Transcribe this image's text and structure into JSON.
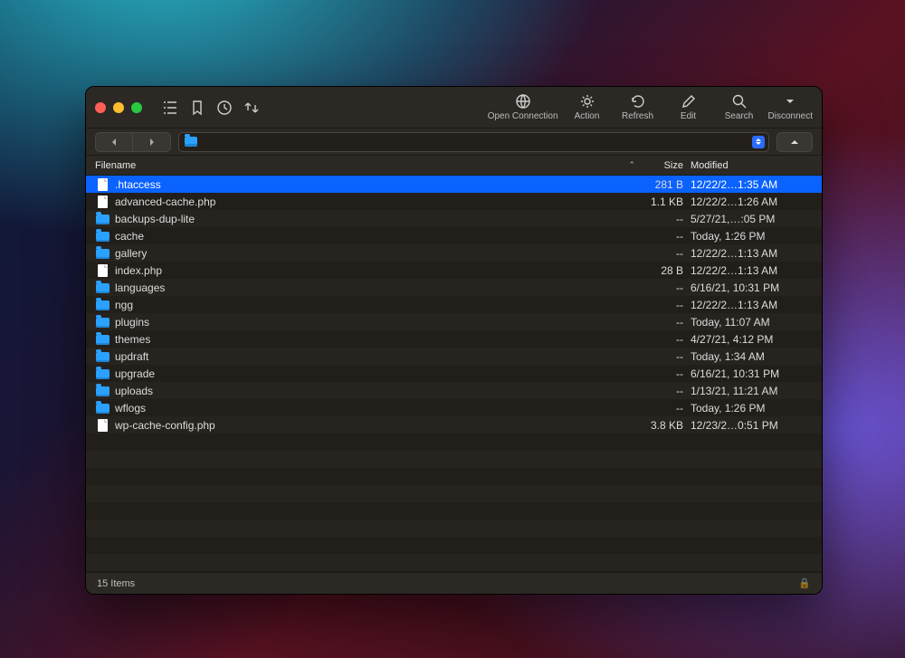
{
  "toolbar": {
    "buttons": {
      "open_connection": "Open Connection",
      "action": "Action",
      "refresh": "Refresh",
      "edit": "Edit",
      "search": "Search",
      "disconnect": "Disconnect"
    }
  },
  "path": {
    "value": ""
  },
  "columns": {
    "filename": "Filename",
    "size": "Size",
    "modified": "Modified"
  },
  "files": [
    {
      "name": ".htaccess",
      "type": "file",
      "size": "281 B",
      "modified": "12/22/2…1:35 AM",
      "selected": true
    },
    {
      "name": "advanced-cache.php",
      "type": "file",
      "size": "1.1 KB",
      "modified": "12/22/2…1:26 AM"
    },
    {
      "name": "backups-dup-lite",
      "type": "folder",
      "size": "--",
      "modified": "5/27/21,…:05 PM"
    },
    {
      "name": "cache",
      "type": "folder",
      "size": "--",
      "modified": "Today, 1:26 PM"
    },
    {
      "name": "gallery",
      "type": "folder",
      "size": "--",
      "modified": "12/22/2…1:13 AM"
    },
    {
      "name": "index.php",
      "type": "file",
      "size": "28 B",
      "modified": "12/22/2…1:13 AM"
    },
    {
      "name": "languages",
      "type": "folder",
      "size": "--",
      "modified": "6/16/21, 10:31 PM"
    },
    {
      "name": "ngg",
      "type": "folder",
      "size": "--",
      "modified": "12/22/2…1:13 AM"
    },
    {
      "name": "plugins",
      "type": "folder",
      "size": "--",
      "modified": "Today, 11:07 AM"
    },
    {
      "name": "themes",
      "type": "folder",
      "size": "--",
      "modified": "4/27/21, 4:12 PM"
    },
    {
      "name": "updraft",
      "type": "folder",
      "size": "--",
      "modified": "Today, 1:34 AM"
    },
    {
      "name": "upgrade",
      "type": "folder",
      "size": "--",
      "modified": "6/16/21, 10:31 PM"
    },
    {
      "name": "uploads",
      "type": "folder",
      "size": "--",
      "modified": "1/13/21, 11:21 AM"
    },
    {
      "name": "wflogs",
      "type": "folder",
      "size": "--",
      "modified": "Today, 1:26 PM"
    },
    {
      "name": "wp-cache-config.php",
      "type": "file",
      "size": "3.8 KB",
      "modified": "12/23/2…0:51 PM"
    }
  ],
  "status": {
    "item_count": "15 Items"
  }
}
